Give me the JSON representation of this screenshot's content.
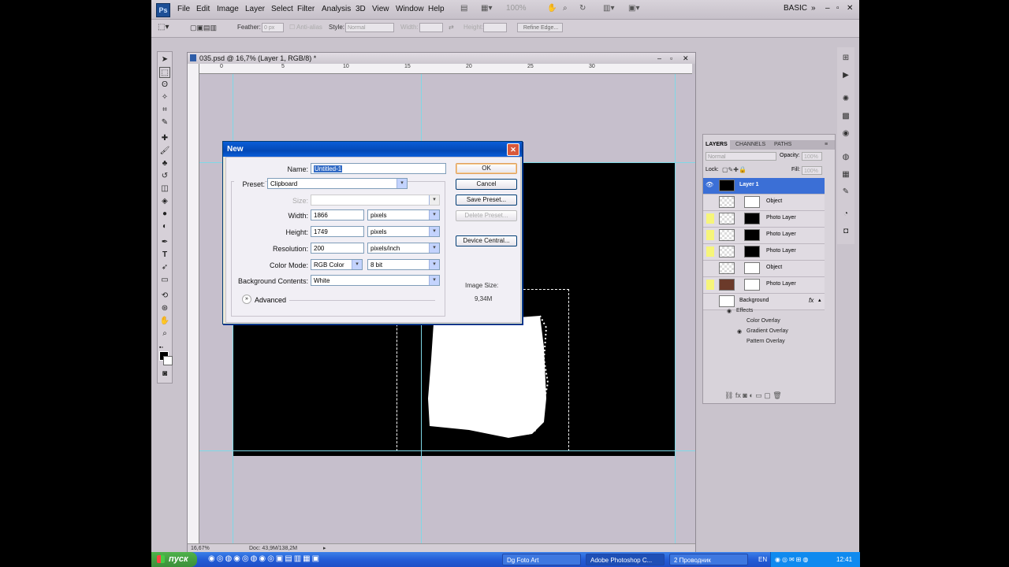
{
  "app": {
    "logo": "Ps",
    "menus": [
      "File",
      "Edit",
      "Image",
      "Layer",
      "Select",
      "Filter",
      "Analysis",
      "3D",
      "View",
      "Window",
      "Help"
    ],
    "zoom_value": "100%",
    "workspace": "BASIC",
    "options": {
      "feather_label": "Feather:",
      "feather_value": "0 px",
      "antialias_label": "Anti-alias",
      "style_label": "Style:",
      "style_value": "Normal",
      "width_label": "Width:",
      "height_label": "Height:",
      "refine_edge": "Refine Edge..."
    }
  },
  "document": {
    "title": "035.psd @ 16,7% (Layer 1, RGB/8) *",
    "status_zoom": "16,67%",
    "status_doc": "Doc: 43,9M/138,2M",
    "ruler_h": [
      "0",
      "5",
      "10",
      "15",
      "20",
      "25",
      "30"
    ]
  },
  "dialog": {
    "title": "New",
    "name_label": "Name:",
    "name_value": "Untitled-1",
    "preset_label": "Preset:",
    "preset_value": "Clipboard",
    "size_label": "Size:",
    "width_label": "Width:",
    "width_value": "1866",
    "width_unit": "pixels",
    "height_label": "Height:",
    "height_value": "1749",
    "height_unit": "pixels",
    "resolution_label": "Resolution:",
    "resolution_value": "200",
    "resolution_unit": "pixels/inch",
    "colormode_label": "Color Mode:",
    "colormode_value": "RGB Color",
    "colormode_depth": "8 bit",
    "bg_label": "Background Contents:",
    "bg_value": "White",
    "advanced_label": "Advanced",
    "ok": "OK",
    "cancel": "Cancel",
    "save_preset": "Save Preset...",
    "delete_preset": "Delete Preset...",
    "device_central": "Device Central...",
    "image_size_label": "Image Size:",
    "image_size_value": "9,34M"
  },
  "layers_panel": {
    "tabs": [
      "LAYERS",
      "CHANNELS",
      "PATHS"
    ],
    "blend_mode": "Normal",
    "opacity_label": "Opacity:",
    "opacity_value": "100%",
    "lock_label": "Lock:",
    "fill_label": "Fill:",
    "fill_value": "100%",
    "layers": [
      {
        "name": "Layer 1"
      },
      {
        "name": "Object"
      },
      {
        "name": "Photo Layer"
      },
      {
        "name": "Photo Layer"
      },
      {
        "name": "Photo Layer"
      },
      {
        "name": "Object"
      },
      {
        "name": "Photo Layer"
      },
      {
        "name": "Background"
      }
    ],
    "effects_label": "Effects",
    "effects": [
      "Color Overlay",
      "Gradient Overlay",
      "Pattern Overlay"
    ]
  },
  "taskbar": {
    "start": "пуск",
    "tasks": [
      "Dg Foto Art",
      "Adobe Photoshop C...",
      "2 Проводник"
    ],
    "lang": "EN",
    "time": "12:41"
  },
  "colors": {
    "accent": "#0a5ed8",
    "ps_bg": "#c9c3cc"
  }
}
